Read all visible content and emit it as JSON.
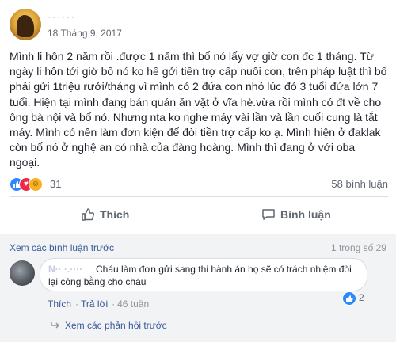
{
  "post": {
    "author_name": "· · · · · ·",
    "date": "18 Tháng 9, 2017",
    "text": "Mình li hôn 2 năm rồi .được 1 năm thì bố nó lấy vợ giờ con đc 1 tháng. Từ ngày li hôn tới giờ bố nó ko hề gởi tiền trợ cấp nuôi con, trên pháp luật thì bố phải gửi 1triệu rưởi/tháng vì mình có 2 đứa con nhỏ lúc đó 3 tuổi đứa lớn 7 tuổi. Hiện tại mình đang bán quán ăn vặt ở vĩa hè.vừa rồi mình có đt về cho ông bà nội và bố nó. Nhưng nta ko nghe máy vài lần và lần cuối cung là tắt máy. Mình có nên làm đơn kiện để đòi tiền trợ cấp ko ạ. Mình hiện ở đaklak còn bố nó ở nghệ an có nhà của đàng hoàng. Mình thì đang ở với oba ngoại."
  },
  "reactions": {
    "count": "31",
    "icons": [
      "like-icon",
      "love-icon",
      "haha-icon"
    ],
    "comments_count": "58 bình luận"
  },
  "actions": {
    "like_label": "Thích",
    "comment_label": "Bình luận"
  },
  "comments": {
    "view_previous": "Xem các bình luận trước",
    "page_count": "1 trong số 29",
    "item": {
      "author": "N·· ·.····",
      "text": "Cháu làm đơn gửi sang thi hành án họ sẽ có trách nhiệm đòi lại công bằng cho cháu",
      "reaction_count": "2",
      "like_label": "Thích",
      "reply_label": "Trả lời",
      "time": "46 tuần",
      "view_replies": "Xem các phản hồi trước"
    }
  },
  "colors": {
    "link": "#385898",
    "like_blue": "#2d88ff",
    "love_red": "#f0284a",
    "haha_yellow": "#f7b125"
  }
}
